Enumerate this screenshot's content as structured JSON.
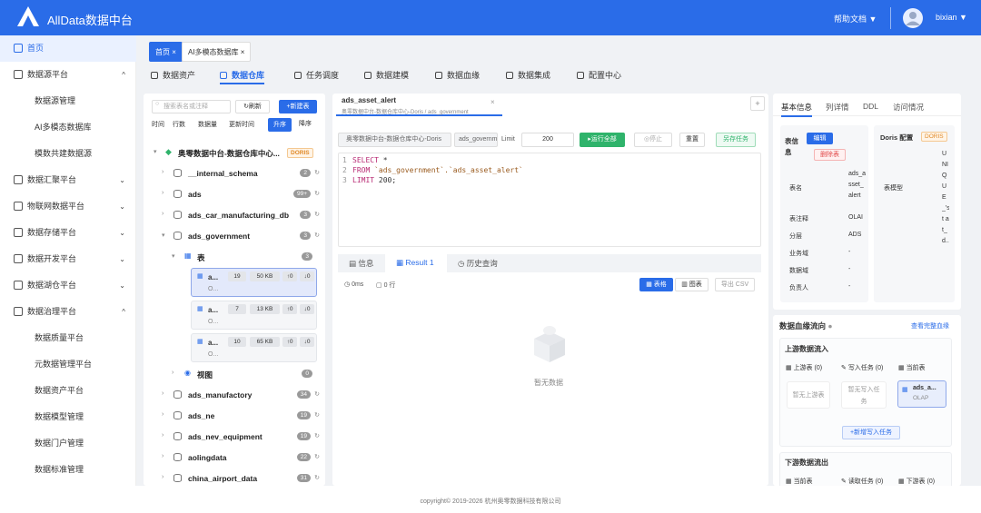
{
  "header": {
    "title": "AllData数据中台",
    "help": "帮助文档 ▼",
    "user": "bixian ▼"
  },
  "sidebar": {
    "items": [
      {
        "label": "首页",
        "caret": ""
      },
      {
        "label": "数据源平台",
        "caret": "^"
      },
      {
        "label": "数据源管理",
        "caret": ""
      },
      {
        "label": "AI多模态数据库",
        "caret": ""
      },
      {
        "label": "模数共建数据源",
        "caret": ""
      },
      {
        "label": "数据汇聚平台",
        "caret": "⌄"
      },
      {
        "label": "物联网数据平台",
        "caret": "⌄"
      },
      {
        "label": "数据存储平台",
        "caret": "⌄"
      },
      {
        "label": "数据开发平台",
        "caret": "⌄"
      },
      {
        "label": "数据湖仓平台",
        "caret": "⌄"
      },
      {
        "label": "数据治理平台",
        "caret": "^"
      },
      {
        "label": "数据质量平台",
        "caret": ""
      },
      {
        "label": "元数据管理平台",
        "caret": ""
      },
      {
        "label": "数据资产平台",
        "caret": ""
      },
      {
        "label": "数据模型管理",
        "caret": ""
      },
      {
        "label": "数据门户管理",
        "caret": ""
      },
      {
        "label": "数据标准管理",
        "caret": ""
      }
    ]
  },
  "page_tabs": [
    {
      "label": "首页 ×"
    },
    {
      "label": "AI多模态数据库 ×"
    }
  ],
  "top_nav": [
    {
      "label": "数据资产"
    },
    {
      "label": "数据仓库"
    },
    {
      "label": "任务调度"
    },
    {
      "label": "数据建模"
    },
    {
      "label": "数据血缘"
    },
    {
      "label": "数据集成"
    },
    {
      "label": "配置中心"
    }
  ],
  "left": {
    "search_placeholder": "搜索表名或注释",
    "refresh": "↻刷新",
    "new_table": "+新建表",
    "sort": {
      "time": "时间",
      "rows": "行数",
      "size": "数据量",
      "update": "更新时间",
      "asc": "升序",
      "desc": "降序"
    },
    "catalog": {
      "name": "奥零数据中台-数据仓库中心...",
      "tag": "DORIS"
    },
    "dbs": [
      {
        "name": "__internal_schema",
        "count": "2"
      },
      {
        "name": "ads",
        "count": "99+"
      },
      {
        "name": "ads_car_manufacturing_db",
        "count": "3"
      },
      {
        "name": "ads_government",
        "count": "3"
      }
    ],
    "tables_label": "表",
    "tables_count": "3",
    "cards": [
      {
        "name": "a...",
        "rows": "19",
        "size": "50 KB",
        "up": "↑0",
        "down": "↓0",
        "sub": "O..."
      },
      {
        "name": "a...",
        "rows": "7",
        "size": "13 KB",
        "up": "↑0",
        "down": "↓0",
        "sub": "O..."
      },
      {
        "name": "a...",
        "rows": "10",
        "size": "65 KB",
        "up": "↑0",
        "down": "↓0",
        "sub": "O..."
      }
    ],
    "views_label": "视图",
    "views_count": "0",
    "dbs2": [
      {
        "name": "ads_manufactory",
        "count": "34"
      },
      {
        "name": "ads_ne",
        "count": "19"
      },
      {
        "name": "ads_nev_equipment",
        "count": "19"
      },
      {
        "name": "aolingdata",
        "count": "22"
      },
      {
        "name": "china_airport_data",
        "count": "31"
      }
    ]
  },
  "sql": {
    "tab_title": "ads_asset_alert",
    "tab_sub": "奥零数据中台-数据仓库中心-Doris / ads_government",
    "add": "+",
    "ds": "奥零数据中台-数据仓库中心-Doris",
    "db": "ads_government",
    "limit_label": "Limit",
    "limit": "200",
    "run": "▸运行全部",
    "stop": "◎停止",
    "reset": "重置",
    "save": "另存任务",
    "lines": [
      "1",
      "2",
      "3"
    ],
    "code": {
      "l1_kw": "SELECT",
      "l1_rest": " *",
      "l2_kw": "FROM",
      "l2_str": " `ads_government`.`ads_asset_alert`",
      "l3_kw": "LIMIT",
      "l3_rest": " 200;"
    },
    "result_tabs": [
      {
        "label": "信息"
      },
      {
        "label": "Result 1"
      },
      {
        "label": "历史查询"
      }
    ],
    "time": "0ms",
    "rows": "0 行",
    "view_table": "表格",
    "view_chart": "图表",
    "export": "导出 CSV",
    "empty": "暂无数据"
  },
  "right": {
    "tabs": [
      {
        "label": "基本信息"
      },
      {
        "label": "列详情"
      },
      {
        "label": "DDL"
      },
      {
        "label": "访问情况"
      }
    ],
    "info_title": "表信息",
    "edit": "编辑",
    "delete": "删除表",
    "fields": [
      {
        "k": "表名",
        "v": "ads_asset_alert"
      },
      {
        "k": "表注释",
        "v": "OLAI"
      },
      {
        "k": "分层",
        "v": "ADS"
      },
      {
        "k": "业务域",
        "v": "-"
      },
      {
        "k": "数据域",
        "v": "-"
      },
      {
        "k": "负责人",
        "v": "-"
      }
    ],
    "doris_title": "Doris 配置",
    "doris_tag": "DORIS",
    "model_label": "表模型",
    "model_value": "UNIQUE_'st at_d..."
  },
  "lineage": {
    "title": "数据血缘流向",
    "full": "查看完整血缘",
    "up_title": "上游数据流入",
    "up_tables": "上游表 (0)",
    "write_tasks": "写入任务 (0)",
    "current": "当前表",
    "no_up": "暂无上游表",
    "no_write": "暂无写入任务",
    "cur_name": "ads_a...",
    "cur_sub": "OLAP",
    "add_write": "+新增写入任务",
    "down_title": "下游数据流出",
    "cur2": "当前表",
    "read_tasks": "读取任务 (0)",
    "down_tables": "下游表 (0)"
  },
  "footer": "copyright© 2019-2026 杭州奥零数据科技有限公司"
}
